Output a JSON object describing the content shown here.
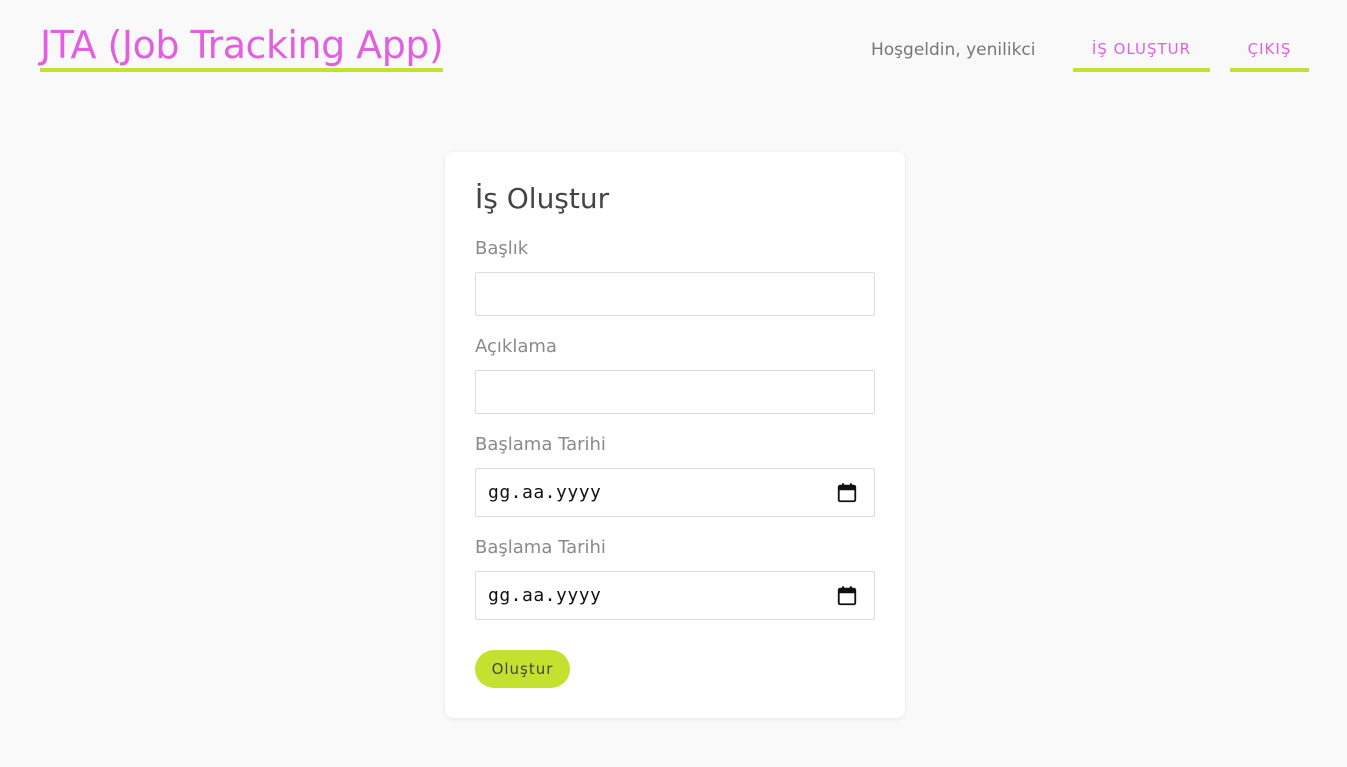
{
  "header": {
    "app_title": "JTA (Job Tracking App)",
    "welcome_text": "Hoşgeldin, yenilikci",
    "nav": {
      "create_label": "İŞ OLUŞTUR",
      "logout_label": "ÇIKIŞ"
    }
  },
  "form": {
    "title": "İş Oluştur",
    "title_field": {
      "label": "Başlık",
      "value": ""
    },
    "description_field": {
      "label": "Açıklama",
      "value": ""
    },
    "start_date_field": {
      "label": "Başlama Tarihi",
      "placeholder": "gg.aa.yyyy"
    },
    "second_date_field": {
      "label": "Başlama Tarihi",
      "placeholder": "gg.aa.yyyy"
    },
    "submit_label": "Oluştur"
  },
  "colors": {
    "brand_pink": "#e060e0",
    "accent_lime": "#c5e12f",
    "background": "#f9f9f9"
  },
  "icons": {
    "date_picker": "calendar-icon"
  }
}
